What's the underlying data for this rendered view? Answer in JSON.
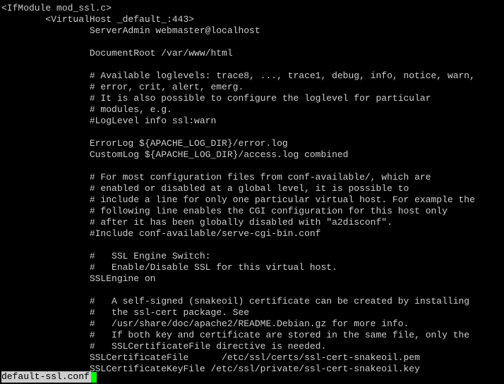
{
  "lines": [
    "<IfModule mod_ssl.c>",
    "        <VirtualHost _default_:443>",
    "                ServerAdmin webmaster@localhost",
    "",
    "                DocumentRoot /var/www/html",
    "",
    "                # Available loglevels: trace8, ..., trace1, debug, info, notice, warn,",
    "                # error, crit, alert, emerg.",
    "                # It is also possible to configure the loglevel for particular",
    "                # modules, e.g.",
    "                #LogLevel info ssl:warn",
    "",
    "                ErrorLog ${APACHE_LOG_DIR}/error.log",
    "                CustomLog ${APACHE_LOG_DIR}/access.log combined",
    "",
    "                # For most configuration files from conf-available/, which are",
    "                # enabled or disabled at a global level, it is possible to",
    "                # include a line for only one particular virtual host. For example the",
    "                # following line enables the CGI configuration for this host only",
    "                # after it has been globally disabled with \"a2disconf\".",
    "                #Include conf-available/serve-cgi-bin.conf",
    "",
    "                #   SSL Engine Switch:",
    "                #   Enable/Disable SSL for this virtual host.",
    "                SSLEngine on",
    "",
    "                #   A self-signed (snakeoil) certificate can be created by installing",
    "                #   the ssl-cert package. See",
    "                #   /usr/share/doc/apache2/README.Debian.gz for more info.",
    "                #   If both key and certificate are stored in the same file, only the",
    "                #   SSLCertificateFile directive is needed.",
    "                SSLCertificateFile      /etc/ssl/certs/ssl-cert-snakeoil.pem",
    "                SSLCertificateKeyFile /etc/ssl/private/ssl-cert-snakeoil.key"
  ],
  "status_filename": "default-ssl.conf"
}
